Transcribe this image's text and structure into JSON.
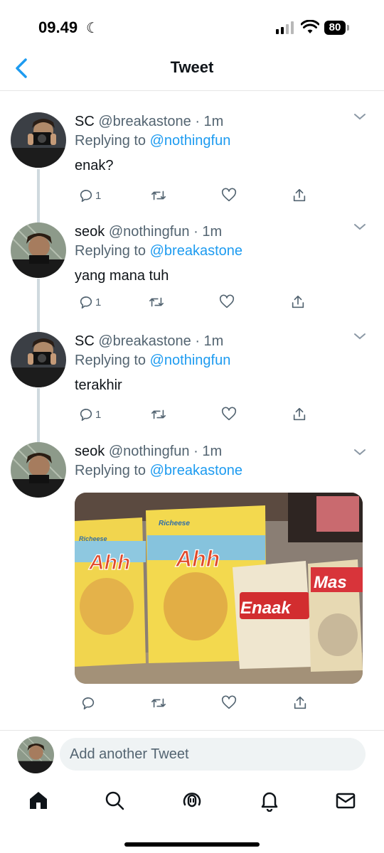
{
  "status_bar": {
    "time": "09.49",
    "battery": "80"
  },
  "nav": {
    "title": "Tweet"
  },
  "tweets": [
    {
      "name": "SC",
      "handle": "@breakastone",
      "dot": "·",
      "age": "1m",
      "replying_prefix": "Replying to",
      "replying_to": "@nothingfun",
      "text": "enak?",
      "reply_count": "1"
    },
    {
      "name": "seok",
      "handle": "@nothingfun",
      "dot": "·",
      "age": "1m",
      "replying_prefix": "Replying to",
      "replying_to": "@breakastone",
      "text": "yang mana tuh",
      "reply_count": "1"
    },
    {
      "name": "SC",
      "handle": "@breakastone",
      "dot": "·",
      "age": "1m",
      "replying_prefix": "Replying to",
      "replying_to": "@nothingfun",
      "text": "terakhir",
      "reply_count": "1"
    },
    {
      "name": "seok",
      "handle": "@nothingfun",
      "dot": "·",
      "age": "1m",
      "replying_prefix": "Replying to",
      "replying_to": "@breakastone",
      "media_labels": [
        "Richeese",
        "Ahh",
        "Richeese",
        "Ahh",
        "Enaak",
        "Mas"
      ]
    }
  ],
  "compose": {
    "placeholder": "Add another Tweet"
  },
  "tabs": [
    "home-icon",
    "search-icon",
    "spaces-icon",
    "notifications-icon",
    "messages-icon"
  ],
  "colors": {
    "accent": "#1d9bf0",
    "secondary_text": "#536471",
    "thread_line": "#cfd9de"
  }
}
